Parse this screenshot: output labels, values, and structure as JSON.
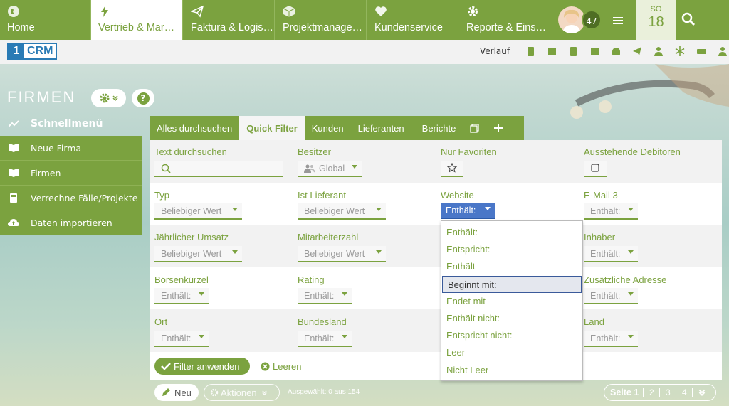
{
  "nav": {
    "tabs": [
      {
        "label": "Home",
        "icon": "globe-icon"
      },
      {
        "label": "Vertrieb & Mar…",
        "icon": "lightning-icon"
      },
      {
        "label": "Faktura & Logis…",
        "icon": "paper-plane-icon"
      },
      {
        "label": "Projektmanage…",
        "icon": "box-icon"
      },
      {
        "label": "Kundenservice",
        "icon": "heart-icon"
      },
      {
        "label": "Reporte & Eins…",
        "icon": "gear-icon"
      }
    ],
    "badge_count": "47",
    "date_dow": "SO",
    "date_day": "18"
  },
  "toolbar": {
    "logo_one": "1",
    "logo_crm": "CRM",
    "history_label": "Verlauf"
  },
  "sidebar": {
    "module_title": "FIRMEN",
    "help": "?",
    "items": [
      {
        "label": "Schnellmenü"
      },
      {
        "label": "Neue Firma"
      },
      {
        "label": "Firmen"
      },
      {
        "label": "Verrechne Fälle/Projekte"
      },
      {
        "label": "Daten importieren"
      }
    ]
  },
  "filter_tabs": [
    "Alles durchsuchen",
    "Quick Filter",
    "Kunden",
    "Lieferanten",
    "Berichte"
  ],
  "filters": {
    "text_search": "Text durchsuchen",
    "owner": "Besitzer",
    "owner_value": "Global",
    "favorites": "Nur Favoriten",
    "receivables": "Ausstehende Debitoren",
    "type": "Typ",
    "type_value": "Beliebiger Wert",
    "supplier": "Ist Lieferant",
    "supplier_value": "Beliebiger Wert",
    "website": "Website",
    "website_value": "Enthält:",
    "email3": "E-Mail 3",
    "email3_value": "Enthält:",
    "revenue": "Jährlicher Umsatz",
    "revenue_value": "Beliebiger Wert",
    "employees": "Mitarbeiterzahl",
    "employees_value": "Beliebiger Wert",
    "owner2": "Inhaber",
    "owner2_value": "Enthält:",
    "ticker": "Börsenkürzel",
    "ticker_value": "Enthält:",
    "rating": "Rating",
    "rating_value": "Enthält:",
    "addr": "Zusätzliche Adresse",
    "addr_value": "Enthält:",
    "city": "Ort",
    "city_value": "Enthält:",
    "state": "Bundesland",
    "state_value": "Enthält:",
    "country": "Land",
    "country_value": "Enthält:",
    "apply": "Filter anwenden",
    "clear": "Leeren"
  },
  "dropdown": [
    "Enthält:",
    "Entspricht:",
    "Enthält",
    "Beginnt mit:",
    "Endet mit",
    "Enthält nicht:",
    "Entspricht nicht:",
    "Leer",
    "Nicht Leer"
  ],
  "bottom": {
    "new": "Neu",
    "actions": "Aktionen",
    "selected": "Ausgewählt: 0 aus 154",
    "page": "Seite 1",
    "p2": "2",
    "p3": "3",
    "p4": "4"
  },
  "colors": {
    "accent": "#7ba23f",
    "link_blue": "#2a7bb5"
  }
}
